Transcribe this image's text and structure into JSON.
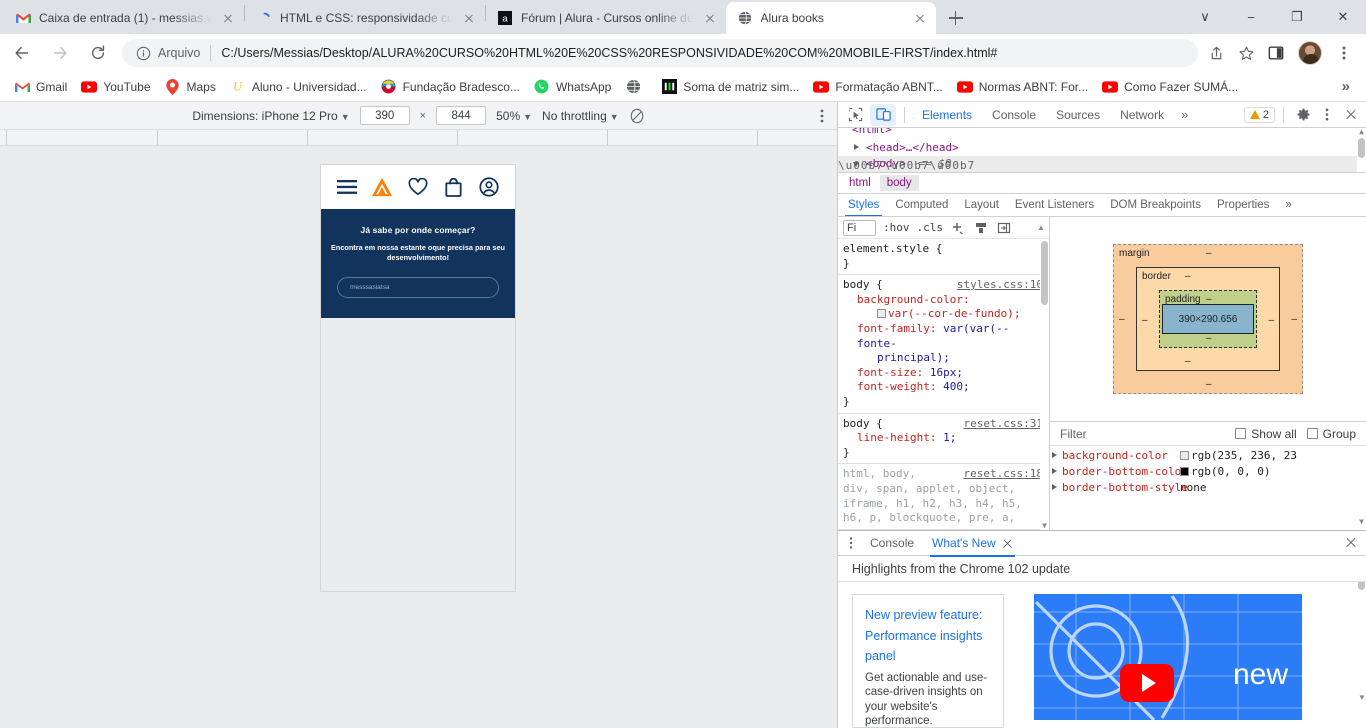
{
  "window": {
    "minimize": "−",
    "maximize": "❐",
    "close": "✕",
    "tab_search": "∨"
  },
  "tabs": [
    {
      "title": "Caixa de entrada (1) - messias.va",
      "favicon": "gmail-icon",
      "active": false
    },
    {
      "title": "HTML e CSS: responsividade com",
      "favicon": "alura-loading-icon",
      "active": false
    },
    {
      "title": "Fórum | Alura - Cursos online de",
      "favicon": "alura-icon",
      "active": false
    },
    {
      "title": "Alura books",
      "favicon": "globe-icon",
      "active": true
    }
  ],
  "toolbar": {
    "back": "←",
    "forward": "→",
    "reload": "↻",
    "scheme_label": "Arquivo",
    "url": "C:/Users/Messias/Desktop/ALURA%20CURSO%20HTML%20E%20CSS%20RESPONSIVIDADE%20COM%20MOBILE-FIRST/index.html#",
    "share_icon": "share-icon",
    "bookmark_icon": "star-icon",
    "sidepanel_icon": "side-panel-icon",
    "profile_icon": "avatar-icon",
    "menu_icon": "kebab-menu-icon"
  },
  "bookmarks": [
    {
      "label": "Gmail",
      "icon": "gmail-icon"
    },
    {
      "label": "YouTube",
      "icon": "youtube-icon"
    },
    {
      "label": "Maps",
      "icon": "maps-icon"
    },
    {
      "label": "Aluno - Universidad...",
      "icon": "u-icon"
    },
    {
      "label": "Fundação Bradesco...",
      "icon": "bradesco-icon"
    },
    {
      "label": "WhatsApp",
      "icon": "whatsapp-icon"
    },
    {
      "label": "",
      "icon": "globe-icon"
    },
    {
      "label": "Soma de matriz sim...",
      "icon": "matrix-icon"
    },
    {
      "label": "Formatação ABNT...",
      "icon": "youtube-icon"
    },
    {
      "label": "Normas ABNT: For...",
      "icon": "youtube-icon"
    },
    {
      "label": "Como Fazer SUMÁ...",
      "icon": "youtube-icon"
    }
  ],
  "bookmarks_overflow": "»",
  "device_toolbar": {
    "dimensions_label": "Dimensions: iPhone 12 Pro",
    "width": "390",
    "height": "844",
    "times": "×",
    "zoom": "50%",
    "throttling": "No throttling",
    "caret": "▼",
    "rotate_icon": "no-throttle-icon",
    "kebab": "⋮"
  },
  "preview": {
    "nav_icons": [
      "hamburger-icon",
      "alura-logo-icon",
      "heart-icon",
      "bag-icon",
      "account-icon"
    ],
    "heading": "Já sabe por onde começar?",
    "subheading": "Encontra em nossa estante oque precisa para seu desenvolvimento!",
    "search_value": "messsasiatsa",
    "hero_bg": "#11335c"
  },
  "devtools": {
    "inspect_icon": "inspect-cursor-icon",
    "device_icon": "device-toggle-icon",
    "panels": [
      "Elements",
      "Console",
      "Sources",
      "Network"
    ],
    "active_panel": "Elements",
    "more_panels": "»",
    "warning_count": "2",
    "settings_icon": "gear-icon",
    "kebab_icon": "kebab-menu-icon",
    "close_icon": "close-icon",
    "tree": [
      {
        "text": "<html>",
        "indent": 0,
        "selected": false,
        "arrow": "none"
      },
      {
        "text": "<head>…</head>",
        "indent": 1,
        "selected": false,
        "arrow": "right"
      },
      {
        "text": "<body>",
        "suffix": "== $0",
        "indent": 1,
        "selected": true,
        "arrow": "down"
      }
    ],
    "breadcrumb": [
      "html",
      "body"
    ],
    "style_tabs": [
      "Styles",
      "Computed",
      "Layout",
      "Event Listeners",
      "DOM Breakpoints",
      "Properties"
    ],
    "style_tabs_overflow": "»",
    "active_style_tab": "Styles",
    "filter_placeholder": "Fi",
    "hov": ":hov",
    "cls": ".cls",
    "plus": "+",
    "rules": [
      {
        "selector": "element.style {",
        "source": "",
        "declarations": [],
        "close": "}"
      },
      {
        "selector": "body {",
        "source": "styles.css:10",
        "declarations": [
          {
            "name": "background-color:",
            "value": "var(--cor-de-fundo);",
            "swatch": true,
            "wrap": true
          },
          {
            "name": "font-family:",
            "value": "var(--fonte-",
            "value2": "principal);",
            "wrap": true
          },
          {
            "name": "font-size:",
            "value": "16px;"
          },
          {
            "name": "font-weight:",
            "value": "400;"
          }
        ],
        "close": "}"
      },
      {
        "selector": "body {",
        "source": "reset.css:31",
        "declarations": [
          {
            "name": "line-height:",
            "value": "1;"
          }
        ],
        "close": "}"
      },
      {
        "selector": "html, body,",
        "source": "reset.css:18",
        "gray_lines": [
          "div, span, applet, object,",
          "iframe, h1, h2, h3, h4, h5,",
          "h6, p, blockquote, pre, a,"
        ]
      }
    ],
    "box_model": {
      "margin_label": "margin",
      "border_label": "border",
      "padding_label": "padding",
      "content": "390×290.656",
      "dash": "–"
    },
    "computed": {
      "filter_placeholder": "Filter",
      "show_all": "Show all",
      "group": "Group",
      "rows": [
        {
          "name": "background-color",
          "value": "rgb(235, 236, 23",
          "swatch": "#ebecef"
        },
        {
          "name": "border-bottom-color",
          "value": "rgb(0, 0, 0)",
          "swatch": "#000000"
        },
        {
          "name": "border-bottom-style",
          "value": "none",
          "swatch": ""
        }
      ]
    },
    "drawer": {
      "kebab": "⋮",
      "tabs": [
        "Console",
        "What's New"
      ],
      "active_tab": "What's New",
      "close_icon": "close-icon",
      "headline": "Highlights from the Chrome 102 update",
      "card": {
        "link_line1": "New preview feature:",
        "link_line2": "Performance insights",
        "link_line3": "panel",
        "description": "Get actionable and use-case-driven insights on your website's performance."
      },
      "media_text": "new",
      "media_bg": "#2b7cf6"
    }
  }
}
